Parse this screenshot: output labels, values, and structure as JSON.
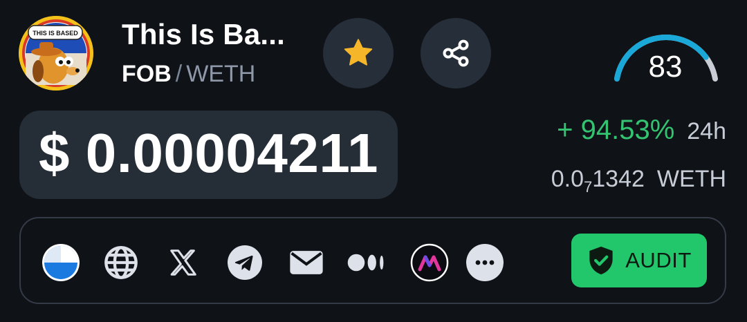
{
  "token": {
    "name": "This Is Ba...",
    "avatar_text": "THIS IS BASED",
    "base_symbol": "FOB",
    "separator": "/",
    "quote_symbol": "WETH"
  },
  "actions": {
    "favorite_icon": "star-icon",
    "share_icon": "share-icon"
  },
  "score": {
    "value": "83",
    "level": 0.83
  },
  "price": {
    "usd": "$ 0.00004211",
    "change_pct": "+ 94.53%",
    "change_period": "24h",
    "weth_prefix": "0.0",
    "weth_zero_count": "7",
    "weth_digits": "1342",
    "weth_unit": "WETH"
  },
  "links": [
    {
      "icon": "chart-icon"
    },
    {
      "icon": "globe-icon"
    },
    {
      "icon": "x-icon"
    },
    {
      "icon": "telegram-icon"
    },
    {
      "icon": "mail-icon"
    },
    {
      "icon": "medium-icon"
    },
    {
      "icon": "app-icon"
    },
    {
      "icon": "more-icon"
    }
  ],
  "audit": {
    "label": "AUDIT",
    "icon": "shield-check-icon"
  },
  "colors": {
    "background": "#0f1217",
    "positive": "#34c471",
    "audit": "#21c76a",
    "gauge": "#1aa8d8",
    "star": "#f5b62a"
  }
}
